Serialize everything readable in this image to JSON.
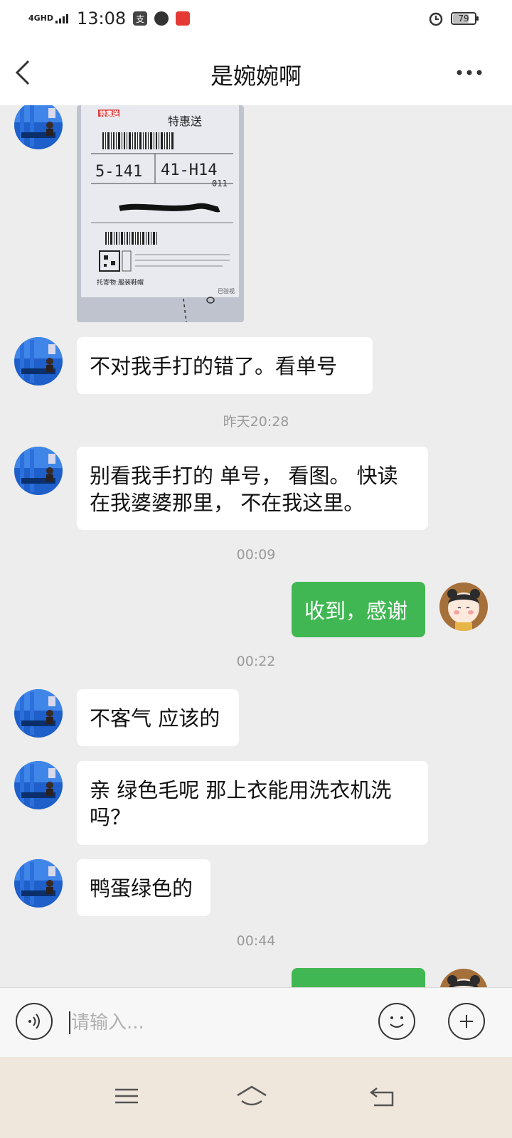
{
  "status_bar": {
    "network": "4GHD",
    "time": "13:08",
    "battery": "79",
    "battery_level": 0.79
  },
  "header": {
    "title": "是婉婉啊"
  },
  "messages": [
    {
      "type": "image",
      "side": "left",
      "label_texts": [
        "特惠送",
        "5-141",
        "41-H14",
        "011",
        "已验视",
        "托寄物:服装鞋帽"
      ]
    },
    {
      "type": "text",
      "side": "left",
      "text": "不对我手打的错了。看单号"
    },
    {
      "type": "time",
      "text": "昨天20:28"
    },
    {
      "type": "text",
      "side": "left",
      "text": "别看我手打的 单号， 看图。 快读在我婆婆那里， 不在我这里。"
    },
    {
      "type": "time",
      "text": "00:09"
    },
    {
      "type": "text",
      "side": "right",
      "text": "收到，感谢"
    },
    {
      "type": "time",
      "text": "00:22"
    },
    {
      "type": "text",
      "side": "left",
      "text": "不客气 应该的"
    },
    {
      "type": "text",
      "side": "left",
      "text": "亲 绿色毛呢 那上衣能用洗衣机洗吗？"
    },
    {
      "type": "text",
      "side": "left",
      "text": "鸭蛋绿色的"
    },
    {
      "type": "time",
      "text": "00:44"
    }
  ],
  "input_bar": {
    "placeholder": "请输入..."
  },
  "colors": {
    "accent_green": "#40b753",
    "chat_bg": "#ededed"
  },
  "icons": [
    "back-arrow-icon",
    "more-dots-icon",
    "voice-icon",
    "emoji-icon",
    "plus-icon",
    "menu-icon",
    "home-icon",
    "return-icon"
  ]
}
